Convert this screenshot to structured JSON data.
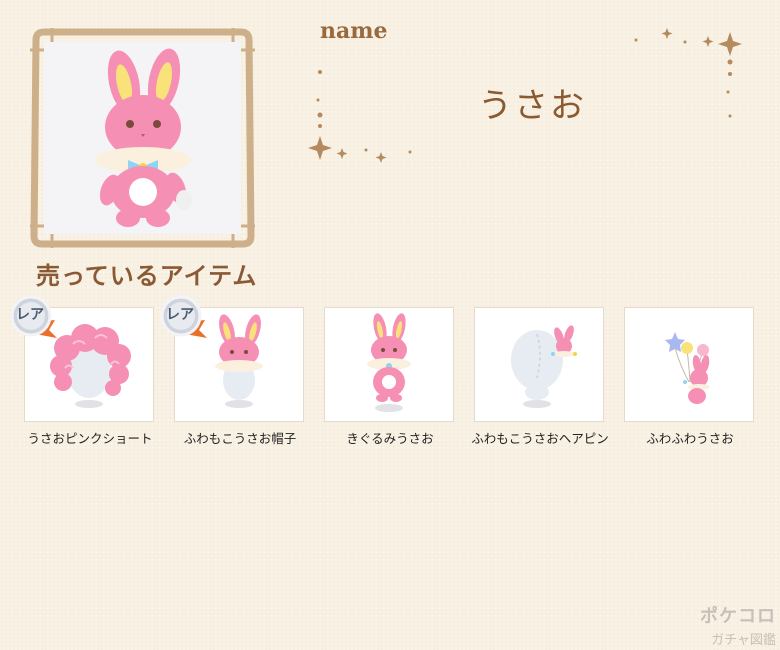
{
  "profile": {
    "name_label": "name",
    "name_value": "うさお",
    "image_icon": "pink-bunny-plush-icon"
  },
  "section": {
    "title": "売っているアイテム"
  },
  "badge": {
    "rare_label": "レア"
  },
  "items": [
    {
      "label": "うさおピンクショート",
      "rare": true,
      "icon": "pink-curly-hair-icon"
    },
    {
      "label": "ふわもこうさお帽子",
      "rare": true,
      "icon": "bunny-hat-icon"
    },
    {
      "label": "きぐるみうさお",
      "rare": false,
      "icon": "bunny-costume-icon"
    },
    {
      "label": "ふわもこうさおヘアピン",
      "rare": false,
      "icon": "bunny-hairpin-icon"
    },
    {
      "label": "ふわふわうさお",
      "rare": false,
      "icon": "bunny-balloon-icon"
    }
  ],
  "watermark": {
    "line1": "ポケコロ",
    "line2": "ガチャ図鑑"
  },
  "colors": {
    "background": "#f8f1e4",
    "frame": "#cdb08a",
    "title_brown": "#8b5a35",
    "bunny_pink": "#f58fb4"
  }
}
